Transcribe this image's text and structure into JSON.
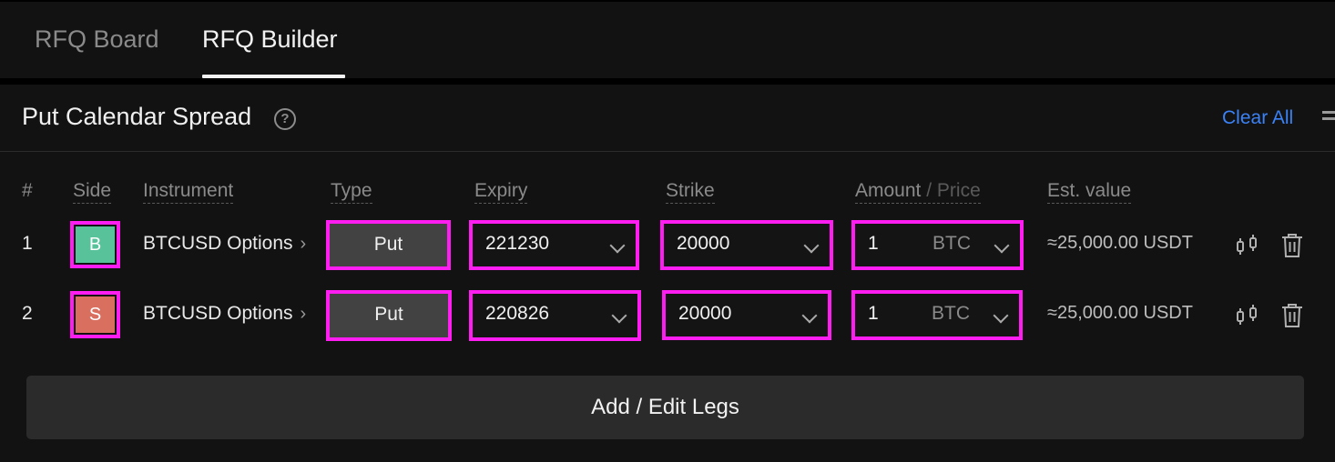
{
  "tabs": [
    {
      "label": "RFQ Board",
      "active": false
    },
    {
      "label": "RFQ Builder",
      "active": true
    }
  ],
  "header": {
    "title": "Put Calendar Spread",
    "help_icon": "?",
    "clear_all_label": "Clear All"
  },
  "columns": {
    "num": "#",
    "side": "Side",
    "instrument": "Instrument",
    "type": "Type",
    "expiry": "Expiry",
    "strike": "Strike",
    "amount": "Amount",
    "amount_sep": "/",
    "price": "Price",
    "est_value": "Est. value"
  },
  "legs": [
    {
      "num": "1",
      "side": "B",
      "instrument": "BTCUSD Options",
      "type": "Put",
      "expiry": "221230",
      "strike": "20000",
      "amount": "1",
      "unit": "BTC",
      "est_value": "≈25,000.00 USDT"
    },
    {
      "num": "2",
      "side": "S",
      "instrument": "BTCUSD Options",
      "type": "Put",
      "expiry": "220826",
      "strike": "20000",
      "amount": "1",
      "unit": "BTC",
      "est_value": "≈25,000.00 USDT"
    }
  ],
  "add_legs_label": "Add / Edit Legs",
  "colors": {
    "accent": "#3b82f6",
    "buy": "#58c39b",
    "sell": "#d9705f",
    "highlight": "#ff1df2"
  },
  "icons": {
    "swap": "swap-icon",
    "delete": "trash-icon",
    "help": "help-icon",
    "menu": "menu-icon"
  }
}
